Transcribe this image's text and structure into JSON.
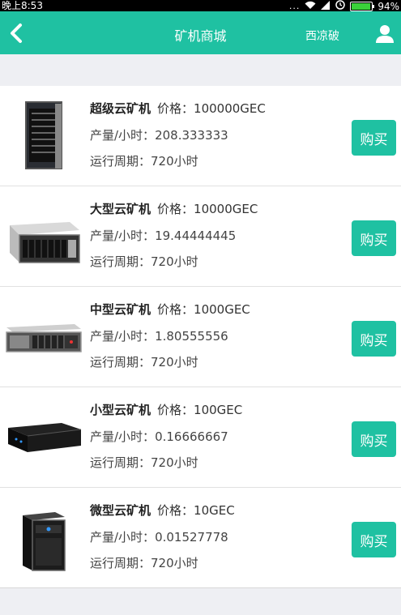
{
  "status_bar": {
    "time": "晚上8:53",
    "dots": "...",
    "battery": "94%",
    "battery_level": 0.94
  },
  "header": {
    "title": "矿机商城",
    "username": "西凉破",
    "back_icon": "chevron-left-icon",
    "user_icon": "user-icon"
  },
  "products": [
    {
      "name": "超级云矿机",
      "price_label": "价格：",
      "price": "100000GEC",
      "output_label": "产量/小时：",
      "output": "208.333333",
      "cycle_label": "运行周期：",
      "cycle": "720小时",
      "buy_label": "购买",
      "image_icon": "tower-server-rack-icon"
    },
    {
      "name": "大型云矿机",
      "price_label": "价格：",
      "price": "10000GEC",
      "output_label": "产量/小时：",
      "output": "19.44444445",
      "cycle_label": "运行周期：",
      "cycle": "720小时",
      "buy_label": "购买",
      "image_icon": "storage-server-icon"
    },
    {
      "name": "中型云矿机",
      "price_label": "价格：",
      "price": "1000GEC",
      "output_label": "产量/小时：",
      "output": "1.80555556",
      "cycle_label": "运行周期：",
      "cycle": "720小时",
      "buy_label": "购买",
      "image_icon": "rack-server-icon"
    },
    {
      "name": "小型云矿机",
      "price_label": "价格：",
      "price": "100GEC",
      "output_label": "产量/小时：",
      "output": "0.16666667",
      "cycle_label": "运行周期：",
      "cycle": "720小时",
      "buy_label": "购买",
      "image_icon": "mini-pc-icon"
    },
    {
      "name": "微型云矿机",
      "price_label": "价格：",
      "price": "10GEC",
      "output_label": "产量/小时：",
      "output": "0.01527778",
      "cycle_label": "运行周期：",
      "cycle": "720小时",
      "buy_label": "购买",
      "image_icon": "micro-server-icon"
    }
  ],
  "colors": {
    "accent": "#1fc1a2",
    "background": "#eeeff3"
  }
}
